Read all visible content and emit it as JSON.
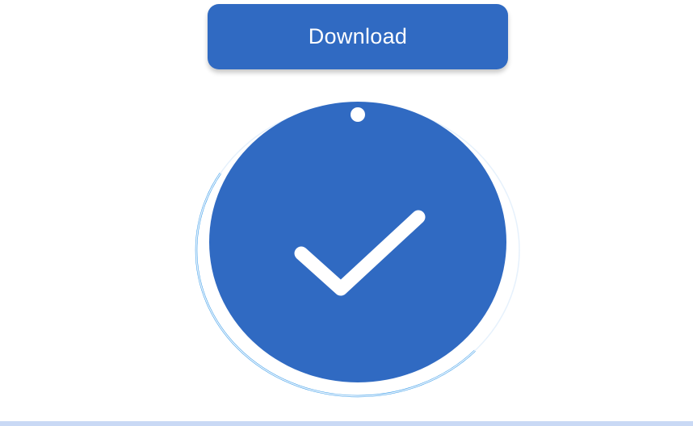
{
  "download_button": {
    "label": "Download"
  },
  "status": {
    "icon": "checkmark-icon",
    "state": "complete",
    "progress": 1.0
  },
  "colors": {
    "accent": "#306ac2",
    "ring": "#2f98e8",
    "background": "#ffffff",
    "bottom_bar": "#c9d9f5",
    "check": "#ffffff"
  }
}
